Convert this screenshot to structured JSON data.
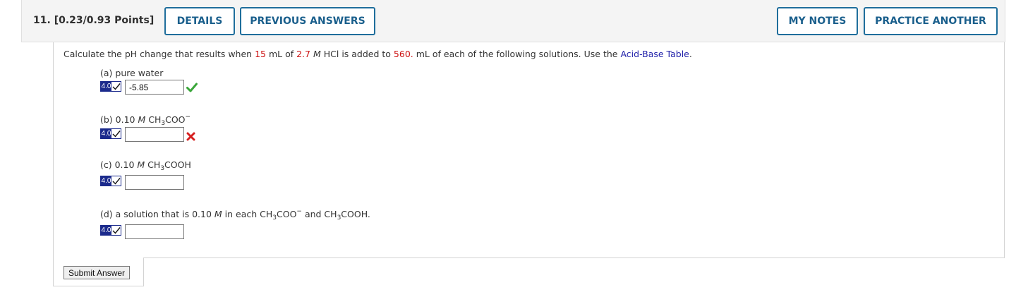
{
  "header": {
    "question_number": "11.",
    "points": "[0.23/0.93 Points]",
    "details_label": "DETAILS",
    "previous_answers_label": "PREVIOUS ANSWERS",
    "my_notes_label": "MY NOTES",
    "practice_another_label": "PRACTICE ANOTHER"
  },
  "question": {
    "text_1": "Calculate the pH change that results when ",
    "volume_added": "15",
    "text_2": " mL of ",
    "concentration": "2.7",
    "text_3": " ",
    "molar_symbol": "M",
    "text_4": " HCl is added to ",
    "volume_solution": "560.",
    "text_5": " mL of each of the following solutions. Use the ",
    "table_link": "Acid-Base Table",
    "text_6": "."
  },
  "parts": {
    "a": {
      "label": "(a) pure water",
      "points": "4.0",
      "value": "-5.85",
      "status": "correct"
    },
    "b": {
      "prefix": "(b) 0.10 ",
      "molar": "M",
      "formula_1": " CH",
      "formula_sub": "3",
      "formula_2": "COO",
      "formula_sup": "−",
      "points": "4.0",
      "value": "",
      "status": "incorrect"
    },
    "c": {
      "prefix": "(c) 0.10 ",
      "molar": "M",
      "formula_1": " CH",
      "formula_sub": "3",
      "formula_2": "COOH",
      "points": "4.0",
      "value": ""
    },
    "d": {
      "prefix": "(d) a solution that is 0.10 ",
      "molar": "M",
      "mid": " in each CH",
      "sub_1": "3",
      "formula_2": "COO",
      "sup": "−",
      "and_text": " and CH",
      "sub_2": "3",
      "formula_3": "COOH.",
      "points": "4.0",
      "value": ""
    }
  },
  "submit_label": "Submit Answer",
  "colors": {
    "accent": "#1f6e9c",
    "badge": "#1b2a8c",
    "correct": "#3aa63a",
    "incorrect": "#d62020",
    "highlight": "#cc1111",
    "link": "#2222aa"
  },
  "icons": {
    "correct": "checkmark-icon",
    "incorrect": "x-mark-icon",
    "badge_check": "check-icon"
  }
}
